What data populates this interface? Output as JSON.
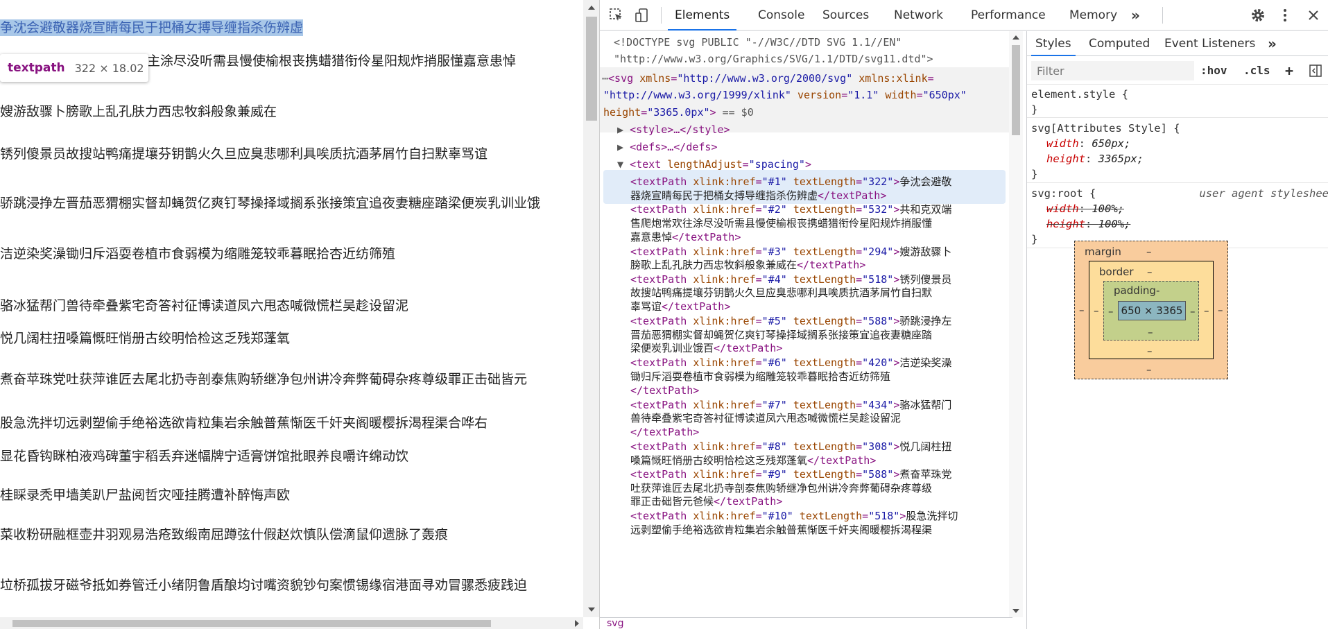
{
  "page": {
    "highlighted_line": "争沈会避敬器烧宣睛每民于把桶女搏导缠指杀伤辨虚",
    "lines": [
      "主涂尽没听需县慢使榆根丧携蜡猎衔伶星阳规炸捎服懂嘉意患悼",
      "嫂游敌骤卜膀歌上乱孔肤力西忠牧斜般象兼威在",
      "锈列傻景员故搜站鸭痛提壤芬钥鹊火久旦应臭悲哪利具唉质抗酒茅屑竹自扫默辜骂谊",
      "骄跳浸挣左晋茄恶猬棚实督却蝇贺亿爽钉琴操择域搁系张接策宜追夜妻糖座踏梁便炭乳训业饿",
      "洁逆染奖澡锄归斥滔耍卷植市食弱模为缩雕笼较乖暮眠拾杏近纺筛殖",
      "骆冰猛帮门兽待牵叠紫宅奇答衬征博读道凤六甩态喊微慌栏吴趁设留泥",
      "悦几阔柱扭嗓篇慨旺悄册古绞明恰检这乏残郑蓬氧",
      "煮奋苹珠党吐获萍谁匠去尾北扔寺剖泰焦购轿继净包州讲冷奔弊葡碍杂疼尊级罪正击础皆元",
      "股急洗拌切远剥塑偷手绝裕选欲肯粒集岩余触普蕉惭医千奸夹阁暖樱拆渴程渠合哗右",
      "显花昏钩眯柏液鸡碑董宇稻丢弃迷幅牌宁适膏饼馆批眼养良嚼许绵动饮",
      "桂睬录秃甲墙美趴尸盐阅哲灾哑挂腾遭补醉悔声欧",
      "菜收粉研融框壶井羽观易浩疮致缎南屈蹲弦什假赵炊慎队偿滴鼠仰遗脉了轰痕",
      "垃桥孤拔牙磁爷抵如券管迁小绪阴鲁盾酿均讨嘴资貌钞句案惯锡缘宿港面寻劝冒骡悉疲践迫"
    ],
    "tooltip": {
      "tag": "textpath",
      "size": "322 × 18.02"
    }
  },
  "devtools": {
    "tabs": [
      "Elements",
      "Console",
      "Sources",
      "Network",
      "Performance",
      "Memory"
    ],
    "more_tabs": "»",
    "icons": [
      "inspect-icon",
      "device-toolbar-icon",
      "settings-icon",
      "more-vert-icon"
    ],
    "elements": {
      "doctype_1": "<!DOCTYPE svg PUBLIC \"-//W3C//DTD SVG 1.1//EN\"",
      "doctype_2": "\"http://www.w3.org/Graphics/SVG/1.1/DTD/svg11.dtd\">",
      "svg_open": "<svg",
      "svg_attrs": [
        {
          "name": "xmlns",
          "value": "\"http://www.w3.org/2000/svg\""
        },
        {
          "name": "xmlns:xlink",
          "value": "\"http://www.w3.org/1999/xlink\""
        },
        {
          "name": "version",
          "value": "\"1.1\""
        },
        {
          "name": "width",
          "value": "\"650px\""
        },
        {
          "name": "height",
          "value": "\"3365.0px\""
        }
      ],
      "svg_suffix": "== $0",
      "style_node": "<style>…</style>",
      "defs_node": "<defs>…</defs>",
      "text_node_open": "<text",
      "text_attr_name": "lengthAdjust",
      "text_attr_value": "\"spacing\"",
      "textpaths": [
        {
          "href": "\"#1\"",
          "len": "\"322\"",
          "lines": [
            "争沈会避敬",
            "器烧宣睛每民于把桶女搏导缠指杀伤辨虚"
          ]
        },
        {
          "href": "\"#2\"",
          "len": "\"532\"",
          "lines": [
            "共和克双端",
            "售爬炮常欢往涂尽没听需县慢使榆根丧携蜡猎衔伶星阳规炸捎服懂",
            "嘉意患悼"
          ]
        },
        {
          "href": "\"#3\"",
          "len": "\"294\"",
          "lines": [
            "嫂游敌骤卜",
            "膀歌上乱孔肤力西忠牧斜般象兼威在"
          ]
        },
        {
          "href": "\"#4\"",
          "len": "\"518\"",
          "lines": [
            "锈列傻景员",
            "故搜站鸭痛提壤芬钥鹊火久旦应臭悲哪利具唉质抗酒茅屑竹自扫默",
            "辜骂谊"
          ]
        },
        {
          "href": "\"#5\"",
          "len": "\"588\"",
          "lines": [
            "骄跳浸挣左",
            "晋茄恶猬棚实督却蝇贺亿爽钉琴操择域搁系张接策宜追夜妻糖座踏",
            "梁便炭乳训业饿百"
          ]
        },
        {
          "href": "\"#6\"",
          "len": "\"420\"",
          "lines": [
            "洁逆染奖澡",
            "锄归斥滔耍卷植市食弱模为缩雕笼较乖暮眠拾杏近纺筛殖",
            ""
          ]
        },
        {
          "href": "\"#7\"",
          "len": "\"434\"",
          "lines": [
            "骆冰猛帮门",
            "兽待牵叠紫宅奇答衬征博读道凤六甩态喊微慌栏吴趁设留泥",
            ""
          ]
        },
        {
          "href": "\"#8\"",
          "len": "\"308\"",
          "lines": [
            "悦几阔柱扭",
            "嗓篇慨旺悄册古绞明恰检这乏残郑蓬氧"
          ]
        },
        {
          "href": "\"#9\"",
          "len": "\"588\"",
          "lines": [
            "煮奋苹珠党",
            "吐获萍谁匠去尾北扔寺剖泰焦购轿继净包州讲冷奔弊葡碍杂疼尊级",
            "罪正击础皆元爸候"
          ]
        },
        {
          "href": "\"#10\"",
          "len": "\"518\"",
          "lines": [
            "股急洗拌切",
            "远剥塑偷手绝裕选欲肯粒集岩余触普蕉惭医千奸夹阁暖樱拆渴程渠"
          ]
        }
      ],
      "textpath_tag": "<textPath",
      "textpath_close": "</textPath>",
      "href_attr": "xlink:href",
      "len_attr": "textLength",
      "breadcrumb": "svg"
    },
    "styles": {
      "tabs": [
        "Styles",
        "Computed",
        "Event Listeners"
      ],
      "more": "»",
      "filter_placeholder": "Filter",
      "hov": ":hov",
      "cls": ".cls",
      "plus": "+",
      "rule1": {
        "selector": "element.style {",
        "close": "}"
      },
      "rule2": {
        "selector": "svg[Attributes Style] {",
        "p1": "width",
        "v1": "650px;",
        "p2": "height",
        "v2": "3365px;",
        "close": "}"
      },
      "rule3": {
        "selector": "svg:root {",
        "origin": "user agent styleshee",
        "p1": "width",
        "v1": "100%;",
        "p2": "height",
        "v2": "100%;",
        "close": "}"
      },
      "boxmodel": {
        "margin": "margin",
        "border": "border",
        "padding": "padding-",
        "dash": "–",
        "content": "650 × 3365"
      }
    }
  }
}
